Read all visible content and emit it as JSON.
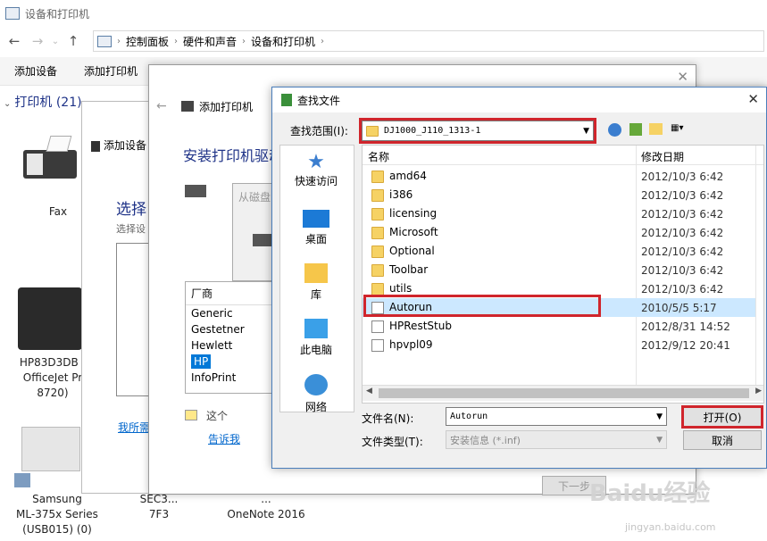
{
  "window_title": "设备和打印机",
  "breadcrumbs": [
    "控制面板",
    "硬件和声音",
    "设备和打印机"
  ],
  "commands": [
    "添加设备",
    "添加打印机"
  ],
  "group_header": "打印机 (21)",
  "devices": [
    {
      "label": "Fax"
    },
    {
      "label": "HP83D3DB (\nOfficeJet Pr\n8720)"
    },
    {
      "label": "Samsung\nML-375x Series\n(USB015) (0)"
    },
    {
      "label": "SEC3...\n7F3"
    },
    {
      "label": "...\nOneNote 2016"
    }
  ],
  "add_device_wizard": {
    "title": "添加设备",
    "heading": "选择",
    "sub": "选择设",
    "link": "我所需"
  },
  "add_printer_wizard": {
    "title": "添加打印机",
    "heading": "安装打印机驱动",
    "manufacturer_header": "厂商",
    "manufacturers": [
      "Generic",
      "Gestetner",
      "Hewlett",
      "HP",
      "InfoPrint"
    ],
    "note": "这个",
    "link": "告诉我",
    "next_button": "下一步"
  },
  "from_disk_title": "从磁盘",
  "file_dialog": {
    "title": "查找文件",
    "lookin_label": "查找范围(I):",
    "lookin_value": "DJ1000_J110_1313-1",
    "places": [
      "快速访问",
      "桌面",
      "库",
      "此电脑",
      "网络"
    ],
    "columns": [
      "名称",
      "修改日期"
    ],
    "files": [
      {
        "name": "amd64",
        "date": "2012/10/3 6:42",
        "type": "folder"
      },
      {
        "name": "i386",
        "date": "2012/10/3 6:42",
        "type": "folder"
      },
      {
        "name": "licensing",
        "date": "2012/10/3 6:42",
        "type": "folder"
      },
      {
        "name": "Microsoft",
        "date": "2012/10/3 6:42",
        "type": "folder"
      },
      {
        "name": "Optional",
        "date": "2012/10/3 6:42",
        "type": "folder"
      },
      {
        "name": "Toolbar",
        "date": "2012/10/3 6:42",
        "type": "folder"
      },
      {
        "name": "utils",
        "date": "2012/10/3 6:42",
        "type": "folder"
      },
      {
        "name": "Autorun",
        "date": "2010/5/5 5:17",
        "type": "file"
      },
      {
        "name": "HPRestStub",
        "date": "2012/8/31 14:52",
        "type": "file"
      },
      {
        "name": "hpvpl09",
        "date": "2012/9/12 20:41",
        "type": "file"
      }
    ],
    "filename_label": "文件名(N):",
    "filename_value": "Autorun",
    "filetype_label": "文件类型(T):",
    "filetype_value": "安装信息 (*.inf)",
    "open_button": "打开(O)",
    "cancel_button": "取消"
  },
  "watermark": "Baidu经验",
  "watermark_sub": "jingyan.baidu.com",
  "colors": {
    "highlight_red": "#d0252c",
    "selection": "#cce8ff",
    "link_blue": "#0066cc"
  }
}
